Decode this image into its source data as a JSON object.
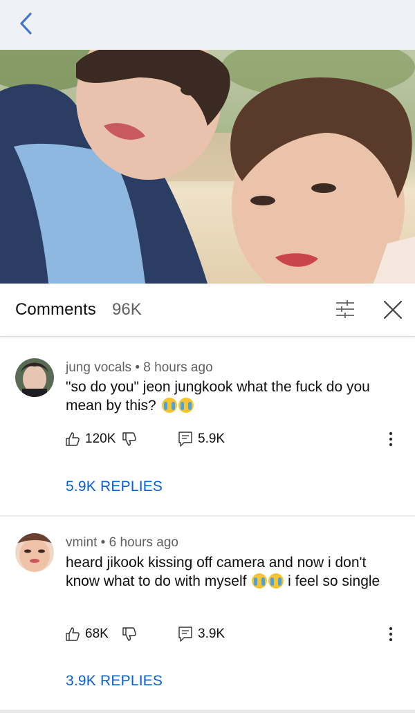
{
  "header": {
    "back_icon": "chevron-left-icon"
  },
  "photo": {
    "description_icon": "photo"
  },
  "comments_panel": {
    "title": "Comments",
    "count": "96K",
    "filter_icon": "sliders-icon",
    "close_icon": "close-icon"
  },
  "comments": [
    {
      "author": "jung vocals",
      "time": "8 hours ago",
      "text": "\"so do you\" jeon jungkook what the fuck do you mean by this?",
      "emojis": 2,
      "likes": "120K",
      "replies_count": "5.9K",
      "replies_link": "5.9K REPLIES"
    },
    {
      "author": "vmint",
      "time": "6 hours ago",
      "text_part1": "heard jikook kissing off camera and now i don't know what to do with myself",
      "text_part2": "i feel so single",
      "emojis": 2,
      "likes": "68K",
      "replies_count": "3.9K",
      "replies_link": "3.9K REPLIES"
    }
  ],
  "separator": " • ",
  "colors": {
    "link": "#065fd4",
    "meta": "#606060",
    "back": "#3f79c8"
  }
}
